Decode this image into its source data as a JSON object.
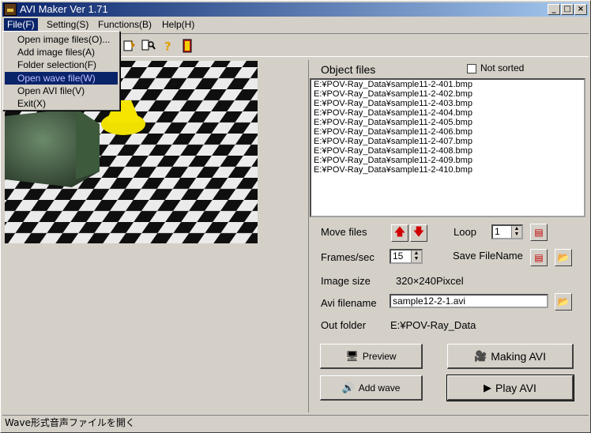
{
  "window": {
    "title": "AVI Maker Ver 1.71"
  },
  "menubar": [
    "File(F)",
    "Setting(S)",
    "Functions(B)",
    "Help(H)"
  ],
  "file_menu": [
    "Open image files(O)...",
    "Add image files(A)",
    "Folder selection(F)",
    "Open wave file(W)",
    "Open AVI file(V)",
    "Exit(X)"
  ],
  "object_files": {
    "label": "Object files",
    "not_sorted_label": "Not sorted",
    "not_sorted_checked": false,
    "items": [
      "E:¥POV-Ray_Data¥sample11-2-401.bmp",
      "E:¥POV-Ray_Data¥sample11-2-402.bmp",
      "E:¥POV-Ray_Data¥sample11-2-403.bmp",
      "E:¥POV-Ray_Data¥sample11-2-404.bmp",
      "E:¥POV-Ray_Data¥sample11-2-405.bmp",
      "E:¥POV-Ray_Data¥sample11-2-406.bmp",
      "E:¥POV-Ray_Data¥sample11-2-407.bmp",
      "E:¥POV-Ray_Data¥sample11-2-408.bmp",
      "E:¥POV-Ray_Data¥sample11-2-409.bmp",
      "E:¥POV-Ray_Data¥sample11-2-410.bmp"
    ]
  },
  "controls": {
    "move_files_label": "Move files",
    "loop_label": "Loop",
    "loop_value": "1",
    "frames_label": "Frames/sec",
    "frames_value": "15",
    "save_filename_label": "Save FileName",
    "image_size_label": "Image size",
    "image_size_value": "320×240Pixcel",
    "avi_filename_label": "Avi filename",
    "avi_filename_value": "sample12-2-1.avi",
    "out_folder_label": "Out folder",
    "out_folder_value": "E:¥POV-Ray_Data"
  },
  "buttons": {
    "preview": "Preview",
    "making_avi": "Making AVI",
    "add_wave": "Add wave",
    "play_avi": "Play AVI"
  },
  "statusbar": {
    "text": "Wave形式音声ファイルを開く"
  }
}
